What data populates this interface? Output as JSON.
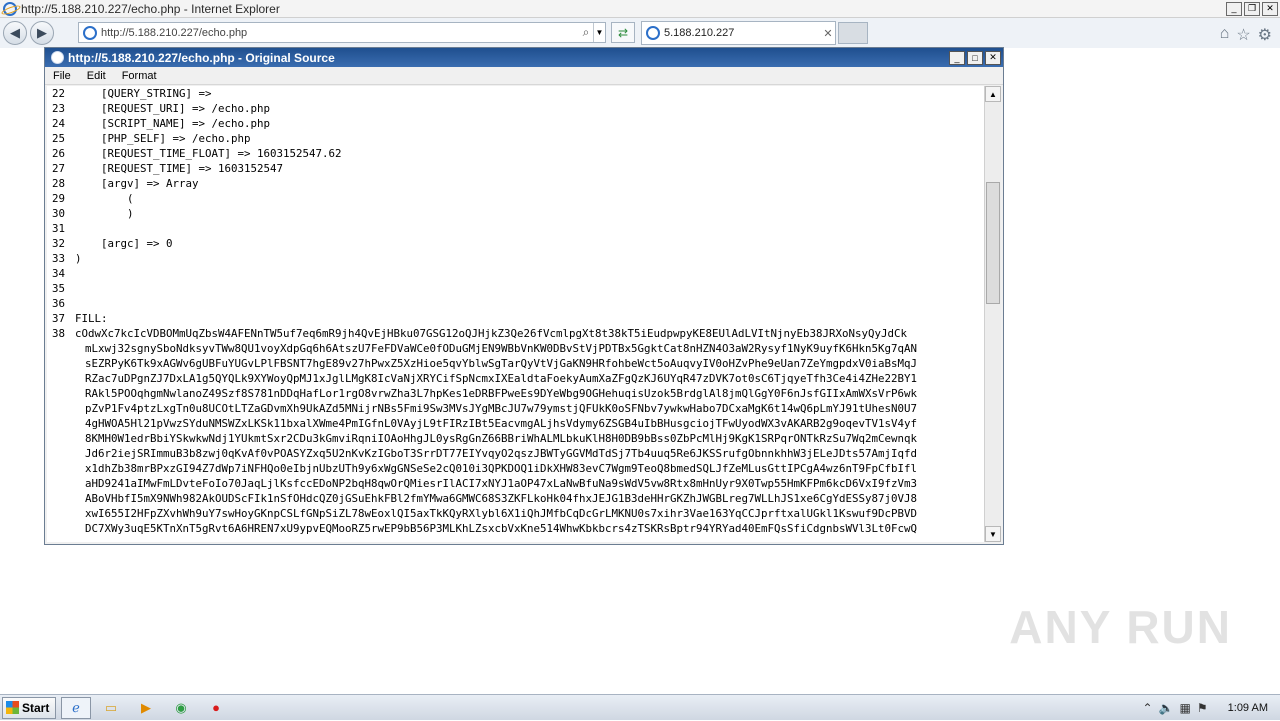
{
  "ie": {
    "window_title": "http://5.188.210.227/echo.php - Internet Explorer",
    "address": "http://5.188.210.227/echo.php",
    "tab_title": "5.188.210.227"
  },
  "source_window": {
    "title": "http://5.188.210.227/echo.php - Original Source",
    "menu": [
      "File",
      "Edit",
      "Format"
    ]
  },
  "code_lines": [
    {
      "n": "22",
      "t": "    [QUERY_STRING] =>"
    },
    {
      "n": "23",
      "t": "    [REQUEST_URI] => /echo.php"
    },
    {
      "n": "24",
      "t": "    [SCRIPT_NAME] => /echo.php"
    },
    {
      "n": "25",
      "t": "    [PHP_SELF] => /echo.php"
    },
    {
      "n": "26",
      "t": "    [REQUEST_TIME_FLOAT] => 1603152547.62"
    },
    {
      "n": "27",
      "t": "    [REQUEST_TIME] => 1603152547"
    },
    {
      "n": "28",
      "t": "    [argv] => Array"
    },
    {
      "n": "29",
      "t": "        ("
    },
    {
      "n": "30",
      "t": "        )"
    },
    {
      "n": "31",
      "t": ""
    },
    {
      "n": "32",
      "t": "    [argc] => 0"
    },
    {
      "n": "33",
      "t": ")"
    },
    {
      "n": "34",
      "t": ""
    },
    {
      "n": "35",
      "t": ""
    },
    {
      "n": "36",
      "t": ""
    },
    {
      "n": "37",
      "t": "FILL:"
    },
    {
      "n": "38",
      "t": "cOdwXc7kcIcVDBOMmUqZbsW4AFENnTW5uf7eq6mR9jh4QvEjHBku07GSG12oQJHjkZ3Qe26fVcmlpgXt8t38kT5iEudpwpyKE8EUlAdLVItNjnyEb38JRXoNsyQyJdCk"
    }
  ],
  "fill_continuation": [
    "mLxwj32sgnySboNdksyvTWw8QU1voyXdpGq6h6AtszU7FeFDVaWCe0fODuGMjEN9WBbVnKW0DBvStVjPDTBx5GgktCat8nHZN4O3aW2Rysyf1NyK9uyfK6Hkn5Kg7qAN",
    "sEZRPyK6Tk9xAGWv6gUBFuYUGvLPlFBSNT7hgE89v27hPwxZ5XzHioe5qvYblwSgTarQyVtVjGaKN9HRfohbeWct5oAuqvyIV0oHZvPhe9eUan7ZeYmgpdxV0iaBsMqJ",
    "RZac7uDPgnZJ7DxLA1g5QYQLk9XYWoyQpMJ1xJglLMgK8IcVaNjXRYCifSpNcmxIXEaldtaFoekyAumXaZFgQzKJ6UYqR47zDVK7ot0sC6TjqyeTfh3Ce4i4ZHe22BY1",
    "RAkl5POOqhgmNwlanoZ49Szf8S781nDDqHafLor1rgO8vrwZha3L7hpKes1eDRBFPweEs9DYeWbg9OGHehuqisUzok5BrdglAl8jmQlGgY0F6nJsfGIIxAmWXsVrP6wk",
    "pZvP1Fv4ptzLxgTn0u8UCOtLTZaGDvmXh9UkAZd5MNijrNBs5Fmi9Sw3MVsJYgMBcJU7w79ymstjQFUkK0oSFNbv7ywkwHabo7DCxaMgK6t14wQ6pLmYJ91tUhesN0U7",
    "4gHWOA5Hl21pVwzSYduNMSWZxLKSk11bxalXWme4PmIGfnL0VAyjL9tFIRzIBt5EacvmgALjhsVdymy6ZSGB4uIbBHusgciojTFwUyodWX3vAKARB2g9oqevTV1sV4yf",
    "8KMH0W1edrBbiYSkwkwNdj1YUkmtSxr2CDu3kGmviRqniIOAoHhgJL0ysRgGnZ66BBriWhALMLbkuKlH8H0DB9bBss0ZbPcMlHj9KgK1SRPqrONTkRzSu7Wq2mCewnqk",
    "Jd6r2iejSRImmuB3b8zwj0qKvAf0vPOASYZxq5U2nKvKzIGboT3SrrDT77EIYvqyO2qszJBWTyGGVMdTdSj7Tb4uuq5Re6JKSSrufgObnnkhhW3jELeJDts57AmjIqfd",
    "x1dhZb38mrBPxzGI94Z7dWp7iNFHQo0eIbjnUbzUTh9y6xWgGNSeSe2cQ010i3QPKDOQ1iDkXHW83evC7Wgm9TeoQ8bmedSQLJfZeMLusGttIPCgA4wz6nT9FpCfbIfl",
    "aHD9241aIMwFmLDvteFoIo70JaqLjlKsfccEDoNP2bqH8qwOrQMiesrIlACI7xNYJ1aOP47xLaNwBfuNa9sWdV5vw8Rtx8mHnUyr9X0Twp55HmKFPm6kcD6VxI9fzVm3",
    "ABoVHbfI5mX9NWh982AkOUDScFIk1nSfOHdcQZ0jGSuEhkFBl2fmYMwa6GMWC68S3ZKFLkoHk04fhxJEJG1B3deHHrGKZhJWGBLreg7WLLhJS1xe6CgYdESSy87j0VJ8",
    "xwI655I2HFpZXvhWh9uY7swHoyGKnpCSLfGNpSiZL78wEoxlQI5axTkKQyRXlybl6X1iQhJMfbCqDcGrLMKNU0s7xihr3Vae163YqCCJprftxalUGkl1Kswuf9DcPBVD",
    "DC7XWy3uqE5KTnXnT5gRvt6A6HREN7xU9ypvEQMooRZ5rwEP9bB56P3MLKhLZsxcbVxKne514WhwKbkbcrs4zTSKRsBptr94YRYad40EmFQsSfiCdgnbsWVl3Lt0FcwQ"
  ],
  "watermark": "ANY RUN",
  "taskbar": {
    "start": "Start",
    "clock": "1:09 AM"
  }
}
